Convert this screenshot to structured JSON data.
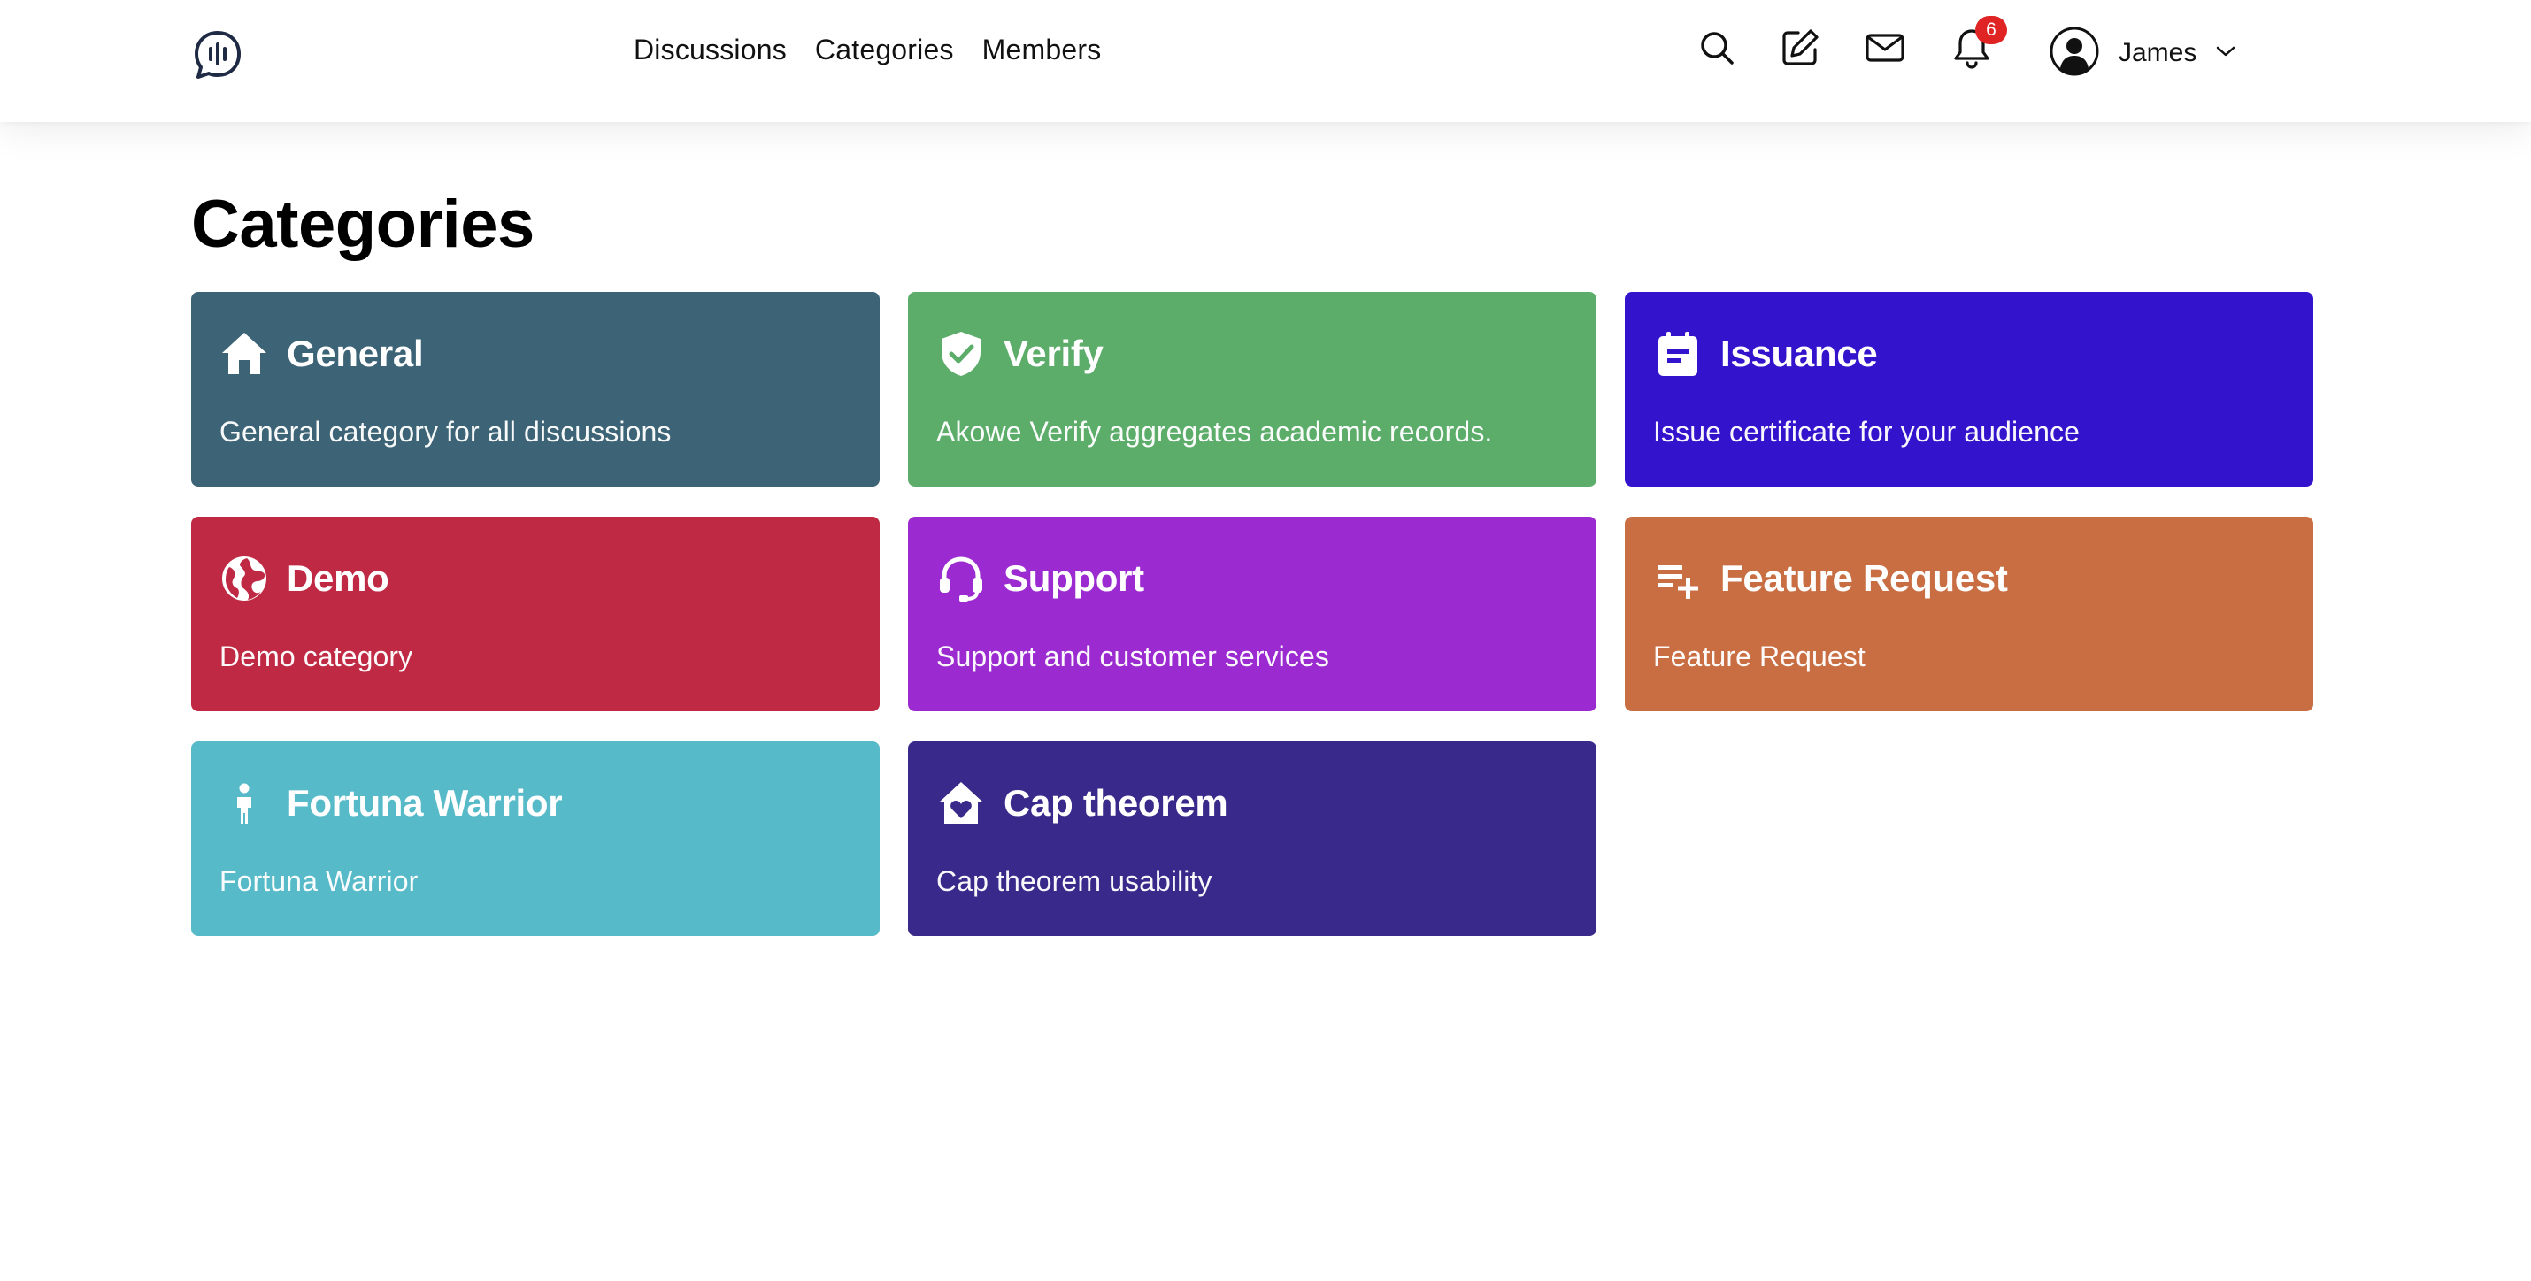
{
  "nav": {
    "discussions": "Discussions",
    "categories": "Categories",
    "members": "Members"
  },
  "notifications": {
    "count": "6",
    "badge_color": "#e02424"
  },
  "user": {
    "name": "James"
  },
  "page": {
    "title": "Categories"
  },
  "categories": [
    {
      "title": "General",
      "description": "General category for all discussions",
      "color": "#3d6476",
      "icon": "home-icon"
    },
    {
      "title": "Verify",
      "description": "Akowe Verify aggregates academic records.",
      "color": "#5cad6a",
      "icon": "shield-check-icon"
    },
    {
      "title": "Issuance",
      "description": "Issue certificate for your audience",
      "color": "#3314cc",
      "icon": "clipboard-icon"
    },
    {
      "title": "Demo",
      "description": "Demo category",
      "color": "#bf2943",
      "icon": "globe-icon"
    },
    {
      "title": "Support",
      "description": "Support and customer services",
      "color": "#9b2bd0",
      "icon": "headset-icon"
    },
    {
      "title": "Feature Request",
      "description": "Feature Request",
      "color": "#c96e43",
      "icon": "playlist-add-icon"
    },
    {
      "title": "Fortuna Warrior",
      "description": "Fortuna Warrior",
      "color": "#57bac9",
      "icon": "child-icon"
    },
    {
      "title": "Cap theorem",
      "description": "Cap theorem usability",
      "color": "#38298a",
      "icon": "heart-house-icon"
    }
  ]
}
